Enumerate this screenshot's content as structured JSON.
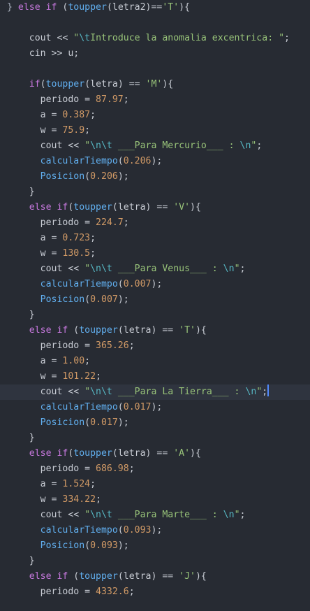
{
  "editor": {
    "colors": {
      "background": "#272b33",
      "active_line": "#2f343f",
      "keyword": "#c678dd",
      "function": "#61afef",
      "string": "#98c379",
      "escape": "#56b6c2",
      "number": "#d19a66",
      "text": "#c8ccd4",
      "cursor": "#528bff"
    },
    "active_line_index": 25,
    "lines": [
      {
        "tokens": [
          [
            "punct",
            "} "
          ],
          [
            "kw",
            "else if"
          ],
          [
            "plain",
            " ("
          ],
          [
            "fn",
            "toupper"
          ],
          [
            "plain",
            "(letra2)=="
          ],
          [
            "str",
            "'T'"
          ],
          [
            "plain",
            "){"
          ]
        ]
      },
      {
        "tokens": []
      },
      {
        "tokens": [
          [
            "plain",
            "    cout << "
          ],
          [
            "str",
            "\""
          ],
          [
            "esc",
            "\\t"
          ],
          [
            "str",
            "Introduce la anomalia excentrica: \""
          ],
          [
            "plain",
            ";"
          ]
        ]
      },
      {
        "tokens": [
          [
            "plain",
            "    cin >> u;"
          ]
        ]
      },
      {
        "tokens": []
      },
      {
        "tokens": [
          [
            "plain",
            "    "
          ],
          [
            "kw",
            "if"
          ],
          [
            "plain",
            "("
          ],
          [
            "fn",
            "toupper"
          ],
          [
            "plain",
            "(letra) == "
          ],
          [
            "str",
            "'M'"
          ],
          [
            "plain",
            "){"
          ]
        ]
      },
      {
        "tokens": [
          [
            "plain",
            "      periodo = "
          ],
          [
            "num",
            "87.97"
          ],
          [
            "plain",
            ";"
          ]
        ]
      },
      {
        "tokens": [
          [
            "plain",
            "      a = "
          ],
          [
            "num",
            "0.387"
          ],
          [
            "plain",
            ";"
          ]
        ]
      },
      {
        "tokens": [
          [
            "plain",
            "      w = "
          ],
          [
            "num",
            "75.9"
          ],
          [
            "plain",
            ";"
          ]
        ]
      },
      {
        "tokens": [
          [
            "plain",
            "      cout << "
          ],
          [
            "str",
            "\""
          ],
          [
            "esc",
            "\\n\\t"
          ],
          [
            "str",
            " ___Para Mercurio___ : "
          ],
          [
            "esc",
            "\\n"
          ],
          [
            "str",
            "\""
          ],
          [
            "plain",
            ";"
          ]
        ]
      },
      {
        "tokens": [
          [
            "plain",
            "      "
          ],
          [
            "fn",
            "calcularTiempo"
          ],
          [
            "plain",
            "("
          ],
          [
            "num",
            "0.206"
          ],
          [
            "plain",
            ");"
          ]
        ]
      },
      {
        "tokens": [
          [
            "plain",
            "      "
          ],
          [
            "fn",
            "Posicion"
          ],
          [
            "plain",
            "("
          ],
          [
            "num",
            "0.206"
          ],
          [
            "plain",
            ");"
          ]
        ]
      },
      {
        "tokens": [
          [
            "plain",
            "    }"
          ]
        ]
      },
      {
        "tokens": [
          [
            "plain",
            "    "
          ],
          [
            "kw",
            "else if"
          ],
          [
            "plain",
            "("
          ],
          [
            "fn",
            "toupper"
          ],
          [
            "plain",
            "(letra) == "
          ],
          [
            "str",
            "'V'"
          ],
          [
            "plain",
            "){"
          ]
        ]
      },
      {
        "tokens": [
          [
            "plain",
            "      periodo = "
          ],
          [
            "num",
            "224.7"
          ],
          [
            "plain",
            ";"
          ]
        ]
      },
      {
        "tokens": [
          [
            "plain",
            "      a = "
          ],
          [
            "num",
            "0.723"
          ],
          [
            "plain",
            ";"
          ]
        ]
      },
      {
        "tokens": [
          [
            "plain",
            "      w = "
          ],
          [
            "num",
            "130.5"
          ],
          [
            "plain",
            ";"
          ]
        ]
      },
      {
        "tokens": [
          [
            "plain",
            "      cout << "
          ],
          [
            "str",
            "\""
          ],
          [
            "esc",
            "\\n\\t"
          ],
          [
            "str",
            " ___Para Venus___ : "
          ],
          [
            "esc",
            "\\n"
          ],
          [
            "str",
            "\""
          ],
          [
            "plain",
            ";"
          ]
        ]
      },
      {
        "tokens": [
          [
            "plain",
            "      "
          ],
          [
            "fn",
            "calcularTiempo"
          ],
          [
            "plain",
            "("
          ],
          [
            "num",
            "0.007"
          ],
          [
            "plain",
            ");"
          ]
        ]
      },
      {
        "tokens": [
          [
            "plain",
            "      "
          ],
          [
            "fn",
            "Posicion"
          ],
          [
            "plain",
            "("
          ],
          [
            "num",
            "0.007"
          ],
          [
            "plain",
            ");"
          ]
        ]
      },
      {
        "tokens": [
          [
            "plain",
            "    }"
          ]
        ]
      },
      {
        "tokens": [
          [
            "plain",
            "    "
          ],
          [
            "kw",
            "else if"
          ],
          [
            "plain",
            " ("
          ],
          [
            "fn",
            "toupper"
          ],
          [
            "plain",
            "(letra) == "
          ],
          [
            "str",
            "'T'"
          ],
          [
            "plain",
            "){"
          ]
        ]
      },
      {
        "tokens": [
          [
            "plain",
            "      periodo = "
          ],
          [
            "num",
            "365.26"
          ],
          [
            "plain",
            ";"
          ]
        ]
      },
      {
        "tokens": [
          [
            "plain",
            "      a = "
          ],
          [
            "num",
            "1.00"
          ],
          [
            "plain",
            ";"
          ]
        ]
      },
      {
        "tokens": [
          [
            "plain",
            "      w = "
          ],
          [
            "num",
            "101.22"
          ],
          [
            "plain",
            ";"
          ]
        ]
      },
      {
        "tokens": [
          [
            "plain",
            "      cout << "
          ],
          [
            "str",
            "\""
          ],
          [
            "esc",
            "\\n\\t"
          ],
          [
            "str",
            " ___Para La Tierra___ : "
          ],
          [
            "esc",
            "\\n"
          ],
          [
            "str",
            "\""
          ],
          [
            "plain",
            ";"
          ]
        ],
        "cursor": true
      },
      {
        "tokens": [
          [
            "plain",
            "      "
          ],
          [
            "fn",
            "calcularTiempo"
          ],
          [
            "plain",
            "("
          ],
          [
            "num",
            "0.017"
          ],
          [
            "plain",
            ");"
          ]
        ]
      },
      {
        "tokens": [
          [
            "plain",
            "      "
          ],
          [
            "fn",
            "Posicion"
          ],
          [
            "plain",
            "("
          ],
          [
            "num",
            "0.017"
          ],
          [
            "plain",
            ");"
          ]
        ]
      },
      {
        "tokens": [
          [
            "plain",
            "    }"
          ]
        ]
      },
      {
        "tokens": [
          [
            "plain",
            "    "
          ],
          [
            "kw",
            "else if"
          ],
          [
            "plain",
            "("
          ],
          [
            "fn",
            "toupper"
          ],
          [
            "plain",
            "(letra) == "
          ],
          [
            "str",
            "'A'"
          ],
          [
            "plain",
            "){"
          ]
        ]
      },
      {
        "tokens": [
          [
            "plain",
            "      periodo = "
          ],
          [
            "num",
            "686.98"
          ],
          [
            "plain",
            ";"
          ]
        ]
      },
      {
        "tokens": [
          [
            "plain",
            "      a = "
          ],
          [
            "num",
            "1.524"
          ],
          [
            "plain",
            ";"
          ]
        ]
      },
      {
        "tokens": [
          [
            "plain",
            "      w = "
          ],
          [
            "num",
            "334.22"
          ],
          [
            "plain",
            ";"
          ]
        ]
      },
      {
        "tokens": [
          [
            "plain",
            "      cout << "
          ],
          [
            "str",
            "\""
          ],
          [
            "esc",
            "\\n\\t"
          ],
          [
            "str",
            " ___Para Marte___ : "
          ],
          [
            "esc",
            "\\n"
          ],
          [
            "str",
            "\""
          ],
          [
            "plain",
            ";"
          ]
        ]
      },
      {
        "tokens": [
          [
            "plain",
            "      "
          ],
          [
            "fn",
            "calcularTiempo"
          ],
          [
            "plain",
            "("
          ],
          [
            "num",
            "0.093"
          ],
          [
            "plain",
            ");"
          ]
        ]
      },
      {
        "tokens": [
          [
            "plain",
            "      "
          ],
          [
            "fn",
            "Posicion"
          ],
          [
            "plain",
            "("
          ],
          [
            "num",
            "0.093"
          ],
          [
            "plain",
            ");"
          ]
        ]
      },
      {
        "tokens": [
          [
            "plain",
            "    }"
          ]
        ]
      },
      {
        "tokens": [
          [
            "plain",
            "    "
          ],
          [
            "kw",
            "else if"
          ],
          [
            "plain",
            " ("
          ],
          [
            "fn",
            "toupper"
          ],
          [
            "plain",
            "(letra) == "
          ],
          [
            "str",
            "'J'"
          ],
          [
            "plain",
            "){"
          ]
        ]
      },
      {
        "tokens": [
          [
            "plain",
            "      periodo = "
          ],
          [
            "num",
            "4332.6"
          ],
          [
            "plain",
            ";"
          ]
        ]
      }
    ]
  }
}
